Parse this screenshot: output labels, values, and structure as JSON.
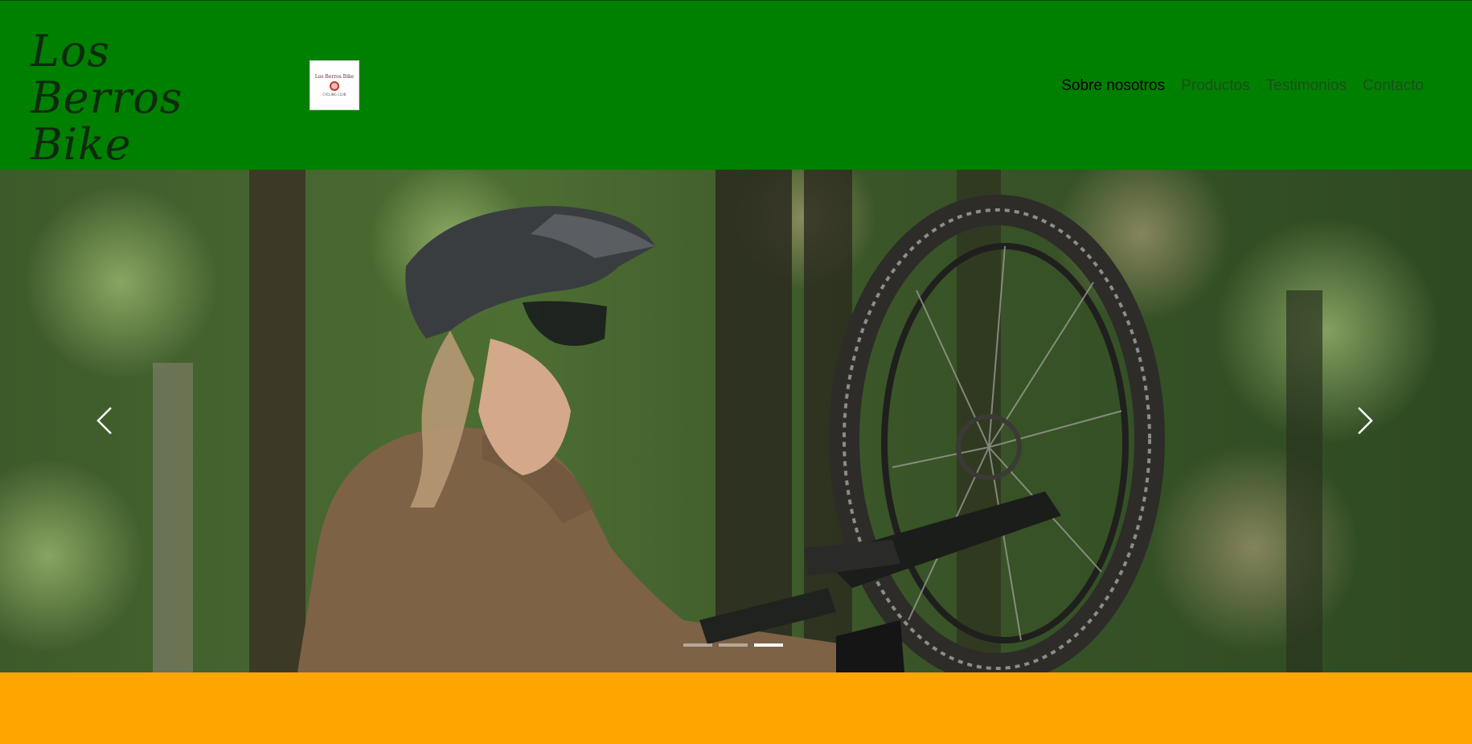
{
  "header": {
    "brand_line1": "Los Berros",
    "brand_line2": "Bike",
    "logo": {
      "text": "Los Berros Bike",
      "subtext": "CYCLING CLUB",
      "icon": "bike-wheel-logo-icon"
    },
    "nav": [
      {
        "label": "Sobre nosotros",
        "active": true
      },
      {
        "label": "Productos",
        "active": false
      },
      {
        "label": "Testimonios",
        "active": false
      },
      {
        "label": "Contacto",
        "active": false
      }
    ]
  },
  "carousel": {
    "image_subject": "Cyclist in helmet and brown jersey lifting a mountain bike wheel in a forest",
    "prev_icon": "chevron-left-icon",
    "next_icon": "chevron-right-icon",
    "slide_count": 3,
    "active_slide": 3
  },
  "colors": {
    "header_bg": "#008000",
    "band_bg": "#ffa500",
    "nav_text": "#1c4d1c",
    "nav_active": "#000000"
  }
}
